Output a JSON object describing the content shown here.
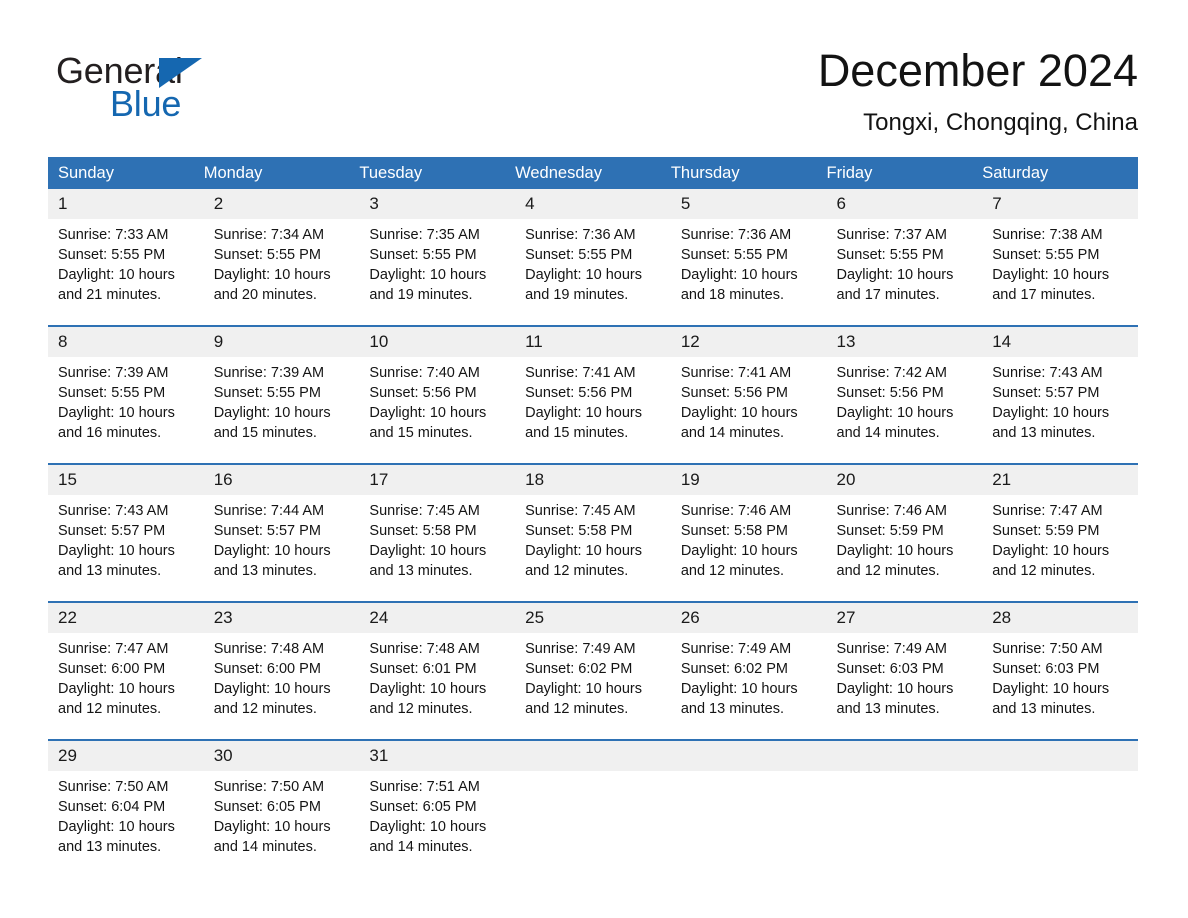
{
  "logo": {
    "word_one": "General",
    "word_two": "Blue",
    "triangle_icon": "blue-triangle-icon",
    "blue": "#1567b0"
  },
  "header": {
    "month_title": "December 2024",
    "location": "Tongxi, Chongqing, China"
  },
  "theme": {
    "header_blue": "#2e71b4",
    "daynum_gray": "#f0f0f0",
    "text_black": "#141414"
  },
  "calendar": {
    "weekday_headers": [
      "Sunday",
      "Monday",
      "Tuesday",
      "Wednesday",
      "Thursday",
      "Friday",
      "Saturday"
    ],
    "weeks": [
      [
        {
          "day": "1",
          "sunrise": "Sunrise: 7:33 AM",
          "sunset": "Sunset: 5:55 PM",
          "daylight_1": "Daylight: 10 hours",
          "daylight_2": "and 21 minutes."
        },
        {
          "day": "2",
          "sunrise": "Sunrise: 7:34 AM",
          "sunset": "Sunset: 5:55 PM",
          "daylight_1": "Daylight: 10 hours",
          "daylight_2": "and 20 minutes."
        },
        {
          "day": "3",
          "sunrise": "Sunrise: 7:35 AM",
          "sunset": "Sunset: 5:55 PM",
          "daylight_1": "Daylight: 10 hours",
          "daylight_2": "and 19 minutes."
        },
        {
          "day": "4",
          "sunrise": "Sunrise: 7:36 AM",
          "sunset": "Sunset: 5:55 PM",
          "daylight_1": "Daylight: 10 hours",
          "daylight_2": "and 19 minutes."
        },
        {
          "day": "5",
          "sunrise": "Sunrise: 7:36 AM",
          "sunset": "Sunset: 5:55 PM",
          "daylight_1": "Daylight: 10 hours",
          "daylight_2": "and 18 minutes."
        },
        {
          "day": "6",
          "sunrise": "Sunrise: 7:37 AM",
          "sunset": "Sunset: 5:55 PM",
          "daylight_1": "Daylight: 10 hours",
          "daylight_2": "and 17 minutes."
        },
        {
          "day": "7",
          "sunrise": "Sunrise: 7:38 AM",
          "sunset": "Sunset: 5:55 PM",
          "daylight_1": "Daylight: 10 hours",
          "daylight_2": "and 17 minutes."
        }
      ],
      [
        {
          "day": "8",
          "sunrise": "Sunrise: 7:39 AM",
          "sunset": "Sunset: 5:55 PM",
          "daylight_1": "Daylight: 10 hours",
          "daylight_2": "and 16 minutes."
        },
        {
          "day": "9",
          "sunrise": "Sunrise: 7:39 AM",
          "sunset": "Sunset: 5:55 PM",
          "daylight_1": "Daylight: 10 hours",
          "daylight_2": "and 15 minutes."
        },
        {
          "day": "10",
          "sunrise": "Sunrise: 7:40 AM",
          "sunset": "Sunset: 5:56 PM",
          "daylight_1": "Daylight: 10 hours",
          "daylight_2": "and 15 minutes."
        },
        {
          "day": "11",
          "sunrise": "Sunrise: 7:41 AM",
          "sunset": "Sunset: 5:56 PM",
          "daylight_1": "Daylight: 10 hours",
          "daylight_2": "and 15 minutes."
        },
        {
          "day": "12",
          "sunrise": "Sunrise: 7:41 AM",
          "sunset": "Sunset: 5:56 PM",
          "daylight_1": "Daylight: 10 hours",
          "daylight_2": "and 14 minutes."
        },
        {
          "day": "13",
          "sunrise": "Sunrise: 7:42 AM",
          "sunset": "Sunset: 5:56 PM",
          "daylight_1": "Daylight: 10 hours",
          "daylight_2": "and 14 minutes."
        },
        {
          "day": "14",
          "sunrise": "Sunrise: 7:43 AM",
          "sunset": "Sunset: 5:57 PM",
          "daylight_1": "Daylight: 10 hours",
          "daylight_2": "and 13 minutes."
        }
      ],
      [
        {
          "day": "15",
          "sunrise": "Sunrise: 7:43 AM",
          "sunset": "Sunset: 5:57 PM",
          "daylight_1": "Daylight: 10 hours",
          "daylight_2": "and 13 minutes."
        },
        {
          "day": "16",
          "sunrise": "Sunrise: 7:44 AM",
          "sunset": "Sunset: 5:57 PM",
          "daylight_1": "Daylight: 10 hours",
          "daylight_2": "and 13 minutes."
        },
        {
          "day": "17",
          "sunrise": "Sunrise: 7:45 AM",
          "sunset": "Sunset: 5:58 PM",
          "daylight_1": "Daylight: 10 hours",
          "daylight_2": "and 13 minutes."
        },
        {
          "day": "18",
          "sunrise": "Sunrise: 7:45 AM",
          "sunset": "Sunset: 5:58 PM",
          "daylight_1": "Daylight: 10 hours",
          "daylight_2": "and 12 minutes."
        },
        {
          "day": "19",
          "sunrise": "Sunrise: 7:46 AM",
          "sunset": "Sunset: 5:58 PM",
          "daylight_1": "Daylight: 10 hours",
          "daylight_2": "and 12 minutes."
        },
        {
          "day": "20",
          "sunrise": "Sunrise: 7:46 AM",
          "sunset": "Sunset: 5:59 PM",
          "daylight_1": "Daylight: 10 hours",
          "daylight_2": "and 12 minutes."
        },
        {
          "day": "21",
          "sunrise": "Sunrise: 7:47 AM",
          "sunset": "Sunset: 5:59 PM",
          "daylight_1": "Daylight: 10 hours",
          "daylight_2": "and 12 minutes."
        }
      ],
      [
        {
          "day": "22",
          "sunrise": "Sunrise: 7:47 AM",
          "sunset": "Sunset: 6:00 PM",
          "daylight_1": "Daylight: 10 hours",
          "daylight_2": "and 12 minutes."
        },
        {
          "day": "23",
          "sunrise": "Sunrise: 7:48 AM",
          "sunset": "Sunset: 6:00 PM",
          "daylight_1": "Daylight: 10 hours",
          "daylight_2": "and 12 minutes."
        },
        {
          "day": "24",
          "sunrise": "Sunrise: 7:48 AM",
          "sunset": "Sunset: 6:01 PM",
          "daylight_1": "Daylight: 10 hours",
          "daylight_2": "and 12 minutes."
        },
        {
          "day": "25",
          "sunrise": "Sunrise: 7:49 AM",
          "sunset": "Sunset: 6:02 PM",
          "daylight_1": "Daylight: 10 hours",
          "daylight_2": "and 12 minutes."
        },
        {
          "day": "26",
          "sunrise": "Sunrise: 7:49 AM",
          "sunset": "Sunset: 6:02 PM",
          "daylight_1": "Daylight: 10 hours",
          "daylight_2": "and 13 minutes."
        },
        {
          "day": "27",
          "sunrise": "Sunrise: 7:49 AM",
          "sunset": "Sunset: 6:03 PM",
          "daylight_1": "Daylight: 10 hours",
          "daylight_2": "and 13 minutes."
        },
        {
          "day": "28",
          "sunrise": "Sunrise: 7:50 AM",
          "sunset": "Sunset: 6:03 PM",
          "daylight_1": "Daylight: 10 hours",
          "daylight_2": "and 13 minutes."
        }
      ],
      [
        {
          "day": "29",
          "sunrise": "Sunrise: 7:50 AM",
          "sunset": "Sunset: 6:04 PM",
          "daylight_1": "Daylight: 10 hours",
          "daylight_2": "and 13 minutes."
        },
        {
          "day": "30",
          "sunrise": "Sunrise: 7:50 AM",
          "sunset": "Sunset: 6:05 PM",
          "daylight_1": "Daylight: 10 hours",
          "daylight_2": "and 14 minutes."
        },
        {
          "day": "31",
          "sunrise": "Sunrise: 7:51 AM",
          "sunset": "Sunset: 6:05 PM",
          "daylight_1": "Daylight: 10 hours",
          "daylight_2": "and 14 minutes."
        },
        {
          "day": "",
          "sunrise": "",
          "sunset": "",
          "daylight_1": "",
          "daylight_2": ""
        },
        {
          "day": "",
          "sunrise": "",
          "sunset": "",
          "daylight_1": "",
          "daylight_2": ""
        },
        {
          "day": "",
          "sunrise": "",
          "sunset": "",
          "daylight_1": "",
          "daylight_2": ""
        },
        {
          "day": "",
          "sunrise": "",
          "sunset": "",
          "daylight_1": "",
          "daylight_2": ""
        }
      ]
    ]
  }
}
